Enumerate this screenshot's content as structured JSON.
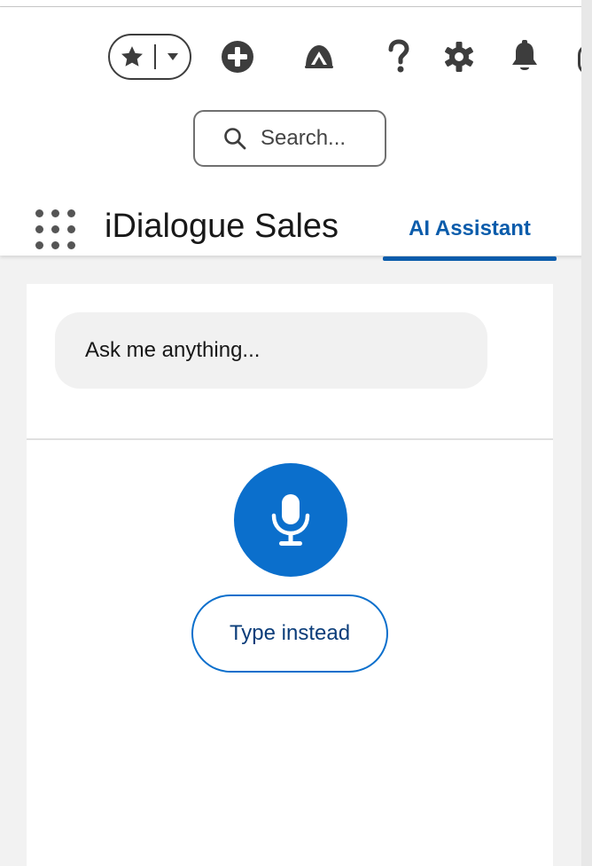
{
  "header": {
    "icons": {
      "favorites": "star-icon",
      "favorites_menu": "caret-down-icon",
      "global_actions": "plus-circle-icon",
      "guidance": "trailhead-icon",
      "help": "question-icon",
      "setup": "gear-icon",
      "notifications": "bell-icon"
    },
    "search": {
      "placeholder": "Search..."
    },
    "app_name": "iDialogue Sales",
    "active_tab": "AI Assistant"
  },
  "assistant": {
    "input_placeholder": "Ask me anything...",
    "mic_icon": "microphone-icon",
    "type_instead_label": "Type instead"
  },
  "colors": {
    "brand_blue": "#0b6fcc",
    "tab_blue": "#0b5cab",
    "icon_gray": "#3d3d3d",
    "page_bg": "#f2f2f2"
  }
}
